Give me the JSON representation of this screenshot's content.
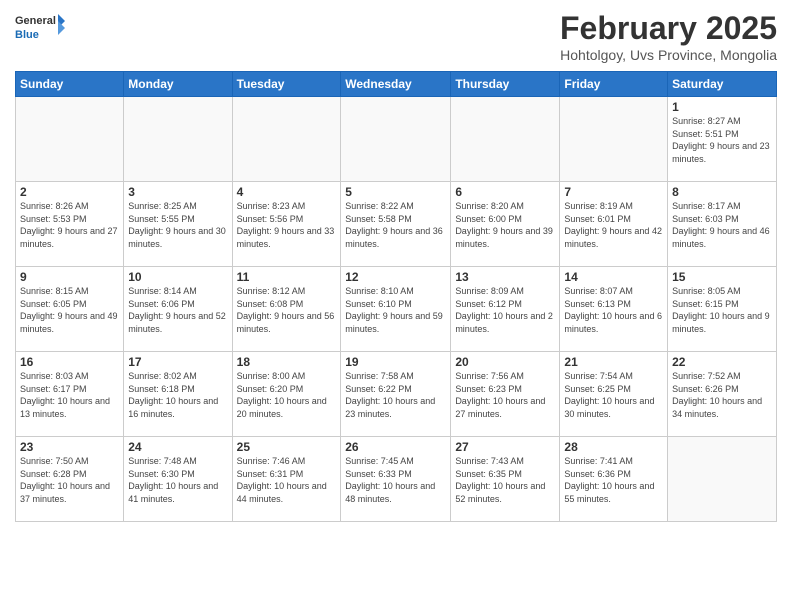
{
  "logo": {
    "general": "General",
    "blue": "Blue"
  },
  "header": {
    "title": "February 2025",
    "subtitle": "Hohtolgoy, Uvs Province, Mongolia"
  },
  "days_of_week": [
    "Sunday",
    "Monday",
    "Tuesday",
    "Wednesday",
    "Thursday",
    "Friday",
    "Saturday"
  ],
  "weeks": [
    [
      {
        "day": "",
        "info": ""
      },
      {
        "day": "",
        "info": ""
      },
      {
        "day": "",
        "info": ""
      },
      {
        "day": "",
        "info": ""
      },
      {
        "day": "",
        "info": ""
      },
      {
        "day": "",
        "info": ""
      },
      {
        "day": "1",
        "info": "Sunrise: 8:27 AM\nSunset: 5:51 PM\nDaylight: 9 hours and 23 minutes."
      }
    ],
    [
      {
        "day": "2",
        "info": "Sunrise: 8:26 AM\nSunset: 5:53 PM\nDaylight: 9 hours and 27 minutes."
      },
      {
        "day": "3",
        "info": "Sunrise: 8:25 AM\nSunset: 5:55 PM\nDaylight: 9 hours and 30 minutes."
      },
      {
        "day": "4",
        "info": "Sunrise: 8:23 AM\nSunset: 5:56 PM\nDaylight: 9 hours and 33 minutes."
      },
      {
        "day": "5",
        "info": "Sunrise: 8:22 AM\nSunset: 5:58 PM\nDaylight: 9 hours and 36 minutes."
      },
      {
        "day": "6",
        "info": "Sunrise: 8:20 AM\nSunset: 6:00 PM\nDaylight: 9 hours and 39 minutes."
      },
      {
        "day": "7",
        "info": "Sunrise: 8:19 AM\nSunset: 6:01 PM\nDaylight: 9 hours and 42 minutes."
      },
      {
        "day": "8",
        "info": "Sunrise: 8:17 AM\nSunset: 6:03 PM\nDaylight: 9 hours and 46 minutes."
      }
    ],
    [
      {
        "day": "9",
        "info": "Sunrise: 8:15 AM\nSunset: 6:05 PM\nDaylight: 9 hours and 49 minutes."
      },
      {
        "day": "10",
        "info": "Sunrise: 8:14 AM\nSunset: 6:06 PM\nDaylight: 9 hours and 52 minutes."
      },
      {
        "day": "11",
        "info": "Sunrise: 8:12 AM\nSunset: 6:08 PM\nDaylight: 9 hours and 56 minutes."
      },
      {
        "day": "12",
        "info": "Sunrise: 8:10 AM\nSunset: 6:10 PM\nDaylight: 9 hours and 59 minutes."
      },
      {
        "day": "13",
        "info": "Sunrise: 8:09 AM\nSunset: 6:12 PM\nDaylight: 10 hours and 2 minutes."
      },
      {
        "day": "14",
        "info": "Sunrise: 8:07 AM\nSunset: 6:13 PM\nDaylight: 10 hours and 6 minutes."
      },
      {
        "day": "15",
        "info": "Sunrise: 8:05 AM\nSunset: 6:15 PM\nDaylight: 10 hours and 9 minutes."
      }
    ],
    [
      {
        "day": "16",
        "info": "Sunrise: 8:03 AM\nSunset: 6:17 PM\nDaylight: 10 hours and 13 minutes."
      },
      {
        "day": "17",
        "info": "Sunrise: 8:02 AM\nSunset: 6:18 PM\nDaylight: 10 hours and 16 minutes."
      },
      {
        "day": "18",
        "info": "Sunrise: 8:00 AM\nSunset: 6:20 PM\nDaylight: 10 hours and 20 minutes."
      },
      {
        "day": "19",
        "info": "Sunrise: 7:58 AM\nSunset: 6:22 PM\nDaylight: 10 hours and 23 minutes."
      },
      {
        "day": "20",
        "info": "Sunrise: 7:56 AM\nSunset: 6:23 PM\nDaylight: 10 hours and 27 minutes."
      },
      {
        "day": "21",
        "info": "Sunrise: 7:54 AM\nSunset: 6:25 PM\nDaylight: 10 hours and 30 minutes."
      },
      {
        "day": "22",
        "info": "Sunrise: 7:52 AM\nSunset: 6:26 PM\nDaylight: 10 hours and 34 minutes."
      }
    ],
    [
      {
        "day": "23",
        "info": "Sunrise: 7:50 AM\nSunset: 6:28 PM\nDaylight: 10 hours and 37 minutes."
      },
      {
        "day": "24",
        "info": "Sunrise: 7:48 AM\nSunset: 6:30 PM\nDaylight: 10 hours and 41 minutes."
      },
      {
        "day": "25",
        "info": "Sunrise: 7:46 AM\nSunset: 6:31 PM\nDaylight: 10 hours and 44 minutes."
      },
      {
        "day": "26",
        "info": "Sunrise: 7:45 AM\nSunset: 6:33 PM\nDaylight: 10 hours and 48 minutes."
      },
      {
        "day": "27",
        "info": "Sunrise: 7:43 AM\nSunset: 6:35 PM\nDaylight: 10 hours and 52 minutes."
      },
      {
        "day": "28",
        "info": "Sunrise: 7:41 AM\nSunset: 6:36 PM\nDaylight: 10 hours and 55 minutes."
      },
      {
        "day": "",
        "info": ""
      }
    ]
  ]
}
